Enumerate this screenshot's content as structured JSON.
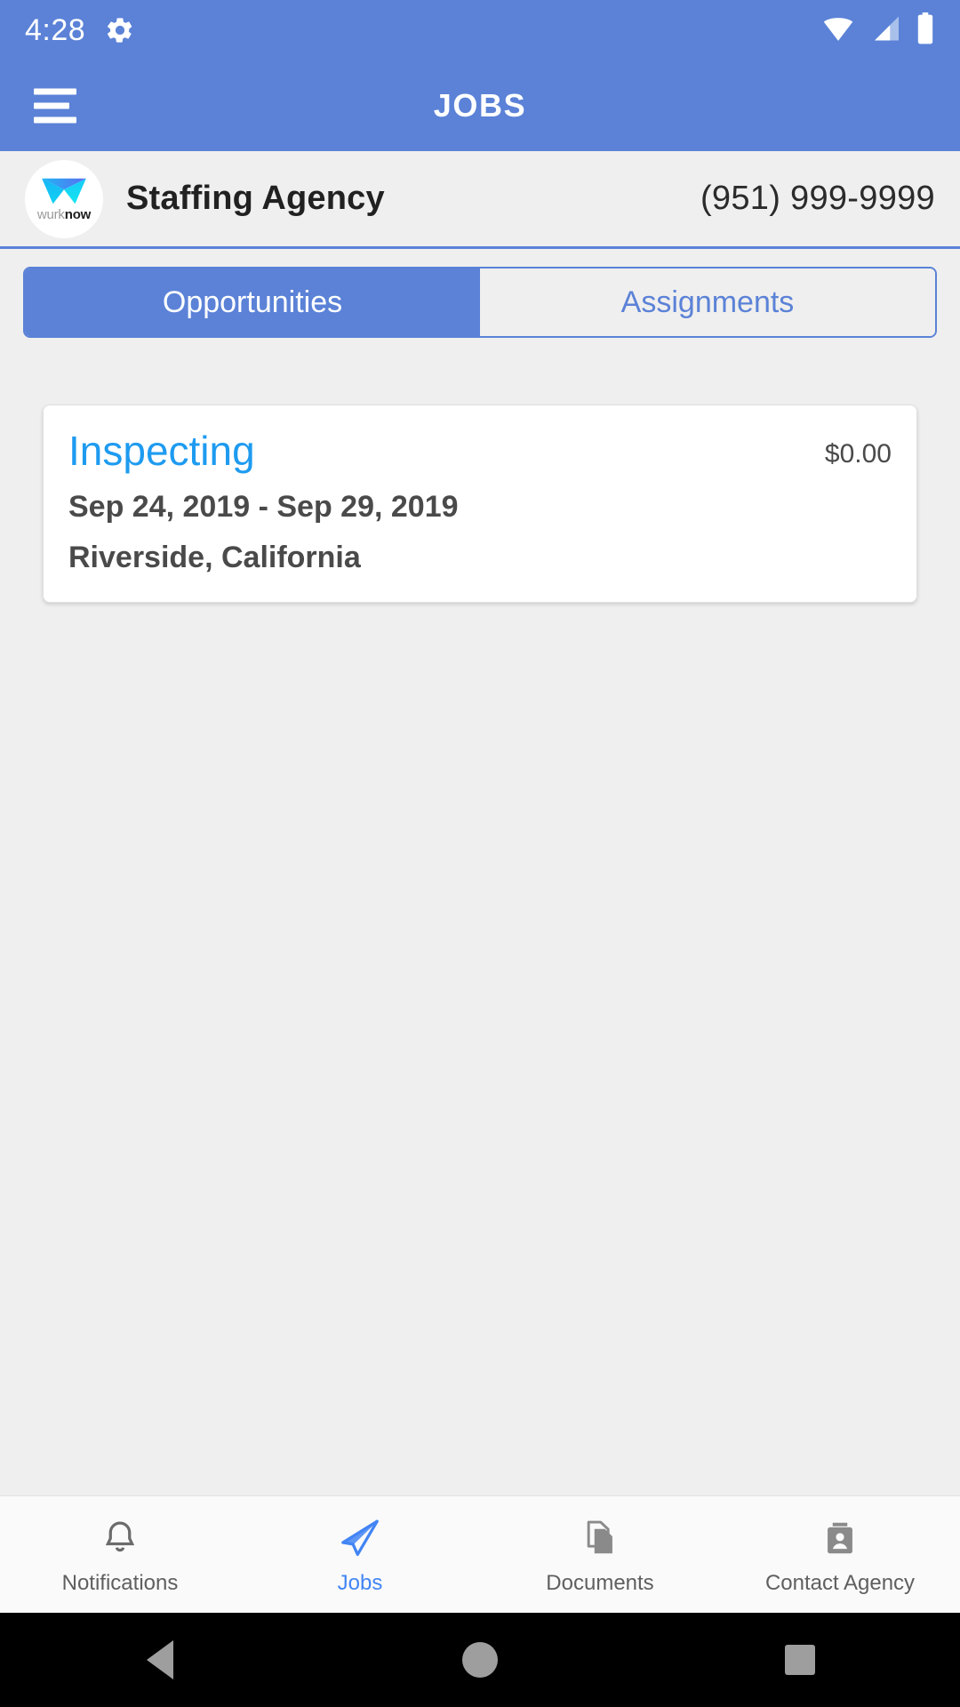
{
  "statusbar": {
    "time": "4:28",
    "icons": [
      "gear-icon",
      "wifi-icon",
      "cellular-signal-icon",
      "battery-icon"
    ]
  },
  "appbar": {
    "menu_icon": "hamburger-menu-icon",
    "title": "JOBS"
  },
  "agency": {
    "logo_text_light": "wurk",
    "logo_text_bold": "now",
    "name": "Staffing Agency",
    "phone": "(951) 999-9999"
  },
  "tabs": [
    {
      "label": "Opportunities",
      "active": true
    },
    {
      "label": "Assignments",
      "active": false
    }
  ],
  "jobs": [
    {
      "title": "Inspecting",
      "price": "$0.00",
      "dates": "Sep 24, 2019 - Sep 29, 2019",
      "location": "Riverside, California"
    }
  ],
  "bottom_nav": [
    {
      "label": "Notifications",
      "icon": "bell-icon",
      "active": false
    },
    {
      "label": "Jobs",
      "icon": "send-icon",
      "active": true
    },
    {
      "label": "Documents",
      "icon": "documents-icon",
      "active": false
    },
    {
      "label": "Contact Agency",
      "icon": "contact-card-icon",
      "active": false
    }
  ],
  "system_nav": {
    "back": "back-triangle-icon",
    "home": "home-circle-icon",
    "recents": "recents-square-icon"
  },
  "colors": {
    "primary": "#5b82d7",
    "accent_link": "#1e9bf0",
    "nav_active": "#4285f4",
    "background": "#efefef",
    "card": "#ffffff"
  }
}
